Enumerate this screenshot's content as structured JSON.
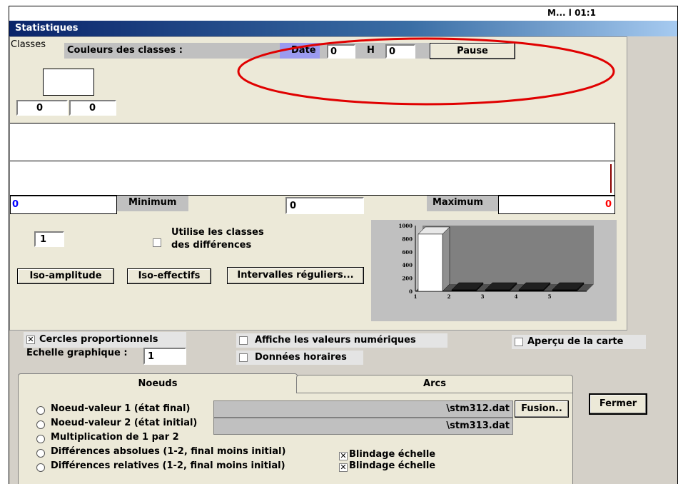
{
  "top_partial_text": "M... l 01:1",
  "window": {
    "title": "Statistiques"
  },
  "classes": {
    "label": "Classes",
    "couleurs_label": "Couleurs des classes :",
    "date_label": "Date",
    "date_value": "0",
    "h_label": "H",
    "h_value": "0",
    "pause_button": "Pause",
    "field_a": "0",
    "field_b": "0"
  },
  "range": {
    "min_left_value": "0",
    "minimum_label": "Minimum",
    "center_value": "0",
    "maximum_label": "Maximum",
    "max_value": "0"
  },
  "classes_count": "1",
  "use_diff_classes": {
    "label_line1": "Utilise les classes",
    "label_line2": "des différences",
    "checked": false
  },
  "buttons": {
    "iso_amplitude": "Iso-amplitude",
    "iso_effectifs": "Iso-effectifs",
    "intervalles": "Intervalles réguliers..."
  },
  "chart_data": {
    "type": "bar",
    "categories": [
      "1",
      "2",
      "3",
      "4",
      "5"
    ],
    "values": [
      870,
      0,
      0,
      0,
      0
    ],
    "y_ticks": [
      "0",
      "200",
      "400",
      "600",
      "800",
      "1000"
    ],
    "ylim": [
      0,
      1000
    ],
    "grid": false
  },
  "options": {
    "cercles": {
      "label": "Cercles proportionnels",
      "checked": true
    },
    "echelle_label": "Echelle graphique :",
    "echelle_value": "1",
    "affiche_valeurs": {
      "label": "Affiche les valeurs numériques",
      "checked": false
    },
    "donnees_horaires": {
      "label": "Données horaires",
      "checked": false
    },
    "apercu": {
      "label": "Aperçu de la carte",
      "checked": false
    }
  },
  "tabs": {
    "noeuds": "Noeuds",
    "arcs": "Arcs"
  },
  "radios": [
    {
      "label": "Noeud-valeur 1 (état final)"
    },
    {
      "label": "Noeud-valeur 2 (état initial)"
    },
    {
      "label": "Multiplication de 1 par 2"
    },
    {
      "label": "Différences absolues (1-2, final moins initial)"
    },
    {
      "label": "Différences relatives (1-2, final moins initial)"
    }
  ],
  "files": {
    "file1": "\\stm312.dat",
    "file2": "\\stm313.dat",
    "fusion_button": "Fusion.."
  },
  "blindage1": {
    "label": "Blindage échelle",
    "checked": true
  },
  "blindage2": {
    "label": "Blindage échelle",
    "checked": true
  },
  "fermer_button": "Fermer",
  "colors": {
    "title_start": "#0a246a",
    "highlight_ellipse": "#e00000",
    "date_label_bg": "#9b9bf0",
    "max_value": "#ff0000"
  }
}
